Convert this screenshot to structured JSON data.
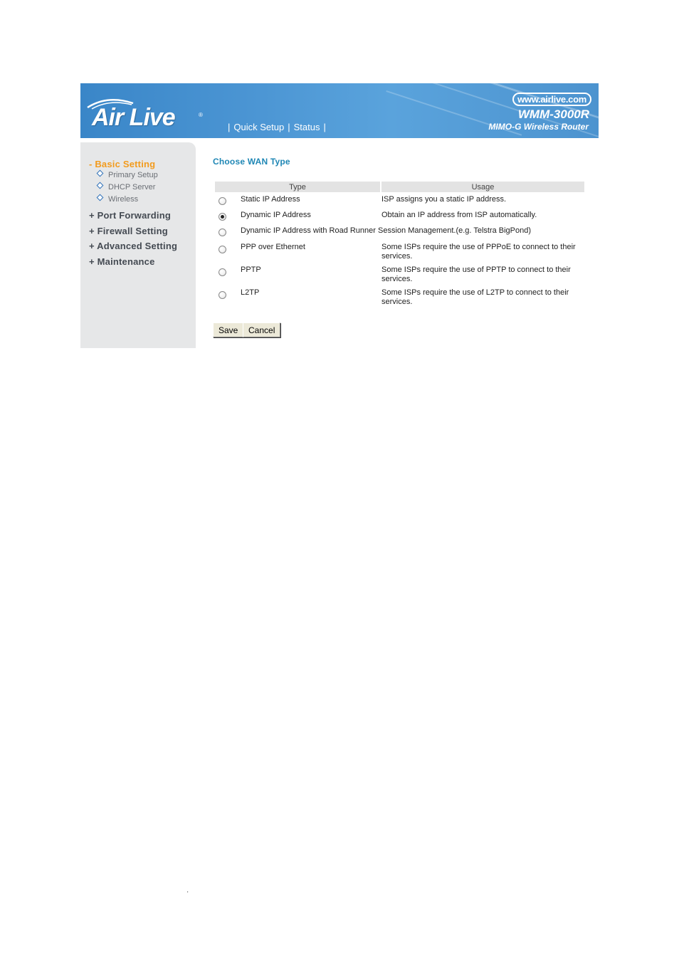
{
  "header": {
    "brand_name": "Air Live",
    "url": "www.airlive.com",
    "model": "WMM-3000R",
    "model_description": "MIMO-G Wireless Router",
    "nav": [
      "Quick Setup",
      "Status"
    ],
    "nav_separator": "|",
    "colors": {
      "banner": "#4c96d4",
      "text": "#ffffff"
    }
  },
  "sidebar": {
    "sections": [
      {
        "label": "- Basic Setting",
        "active": true
      },
      {
        "label": "+ Port Forwarding",
        "active": false
      },
      {
        "label": "+ Firewall Setting",
        "active": false
      },
      {
        "label": "+ Advanced Setting",
        "active": false
      },
      {
        "label": "+ Maintenance",
        "active": false
      }
    ],
    "basic_setting_items": [
      "Primary Setup",
      "DHCP Server",
      "Wireless"
    ],
    "colors": {
      "active": "#f29b1d",
      "background": "#e6e7e8"
    }
  },
  "main": {
    "title": "Choose WAN Type",
    "table": {
      "headers": [
        "Type",
        "Usage"
      ],
      "rows": [
        {
          "type": "Static IP Address",
          "usage": "ISP assigns you a static IP address.",
          "selected": false
        },
        {
          "type": "Dynamic IP Address",
          "usage": "Obtain an IP address from ISP automatically.",
          "selected": true
        },
        {
          "type": "Dynamic IP Address with Road Runner Session Management.(e.g. Telstra BigPond)",
          "usage": "",
          "selected": false
        },
        {
          "type": "PPP over Ethernet",
          "usage": "Some ISPs require the use of PPPoE to connect to their services.",
          "selected": false
        },
        {
          "type": "PPTP",
          "usage": "Some ISPs require the use of PPTP to connect to their services.",
          "selected": false
        },
        {
          "type": "L2TP",
          "usage": "Some ISPs require the use of L2TP to connect to their services.",
          "selected": false
        }
      ]
    },
    "buttons": {
      "save": "Save",
      "cancel": "Cancel"
    },
    "colors": {
      "title": "#1f87b5"
    }
  },
  "footer": {
    "mark": "'"
  }
}
